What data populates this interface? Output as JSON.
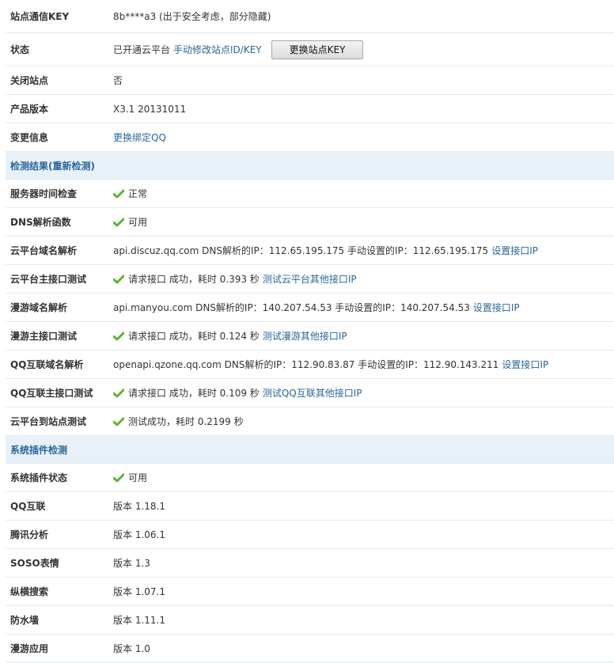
{
  "top": [
    {
      "label": "站点通信KEY",
      "text": "8b****a3 (出于安全考虑，部分隐藏)"
    },
    {
      "label": "状态",
      "text": "已开通云平台",
      "link": "手动修改站点ID/KEY",
      "button": "更换站点KEY"
    },
    {
      "label": "关闭站点",
      "text": "否"
    },
    {
      "label": "产品版本",
      "text": "X3.1 20131011"
    },
    {
      "label": "变更信息",
      "link": "更换绑定QQ"
    }
  ],
  "section1_title": "检测结果(重新检测)",
  "checks": [
    {
      "label": "服务器时间检查",
      "ok": true,
      "text": "正常"
    },
    {
      "label": "DNS解析函数",
      "ok": true,
      "text": "可用"
    },
    {
      "label": "云平台域名解析",
      "text": "api.discuz.qq.com DNS解析的IP：112.65.195.175 手动设置的IP：112.65.195.175",
      "link": "设置接口IP"
    },
    {
      "label": "云平台主接口测试",
      "ok": true,
      "text": "请求接口 成功，耗时 0.393 秒",
      "link": "测试云平台其他接口IP"
    },
    {
      "label": "漫游域名解析",
      "text": "api.manyou.com DNS解析的IP：140.207.54.53 手动设置的IP：140.207.54.53",
      "link": "设置接口IP"
    },
    {
      "label": "漫游主接口测试",
      "ok": true,
      "text": "请求接口 成功，耗时 0.124 秒",
      "link": "测试漫游其他接口IP"
    },
    {
      "label": "QQ互联域名解析",
      "text": "openapi.qzone.qq.com DNS解析的IP：112.90.83.87 手动设置的IP：112.90.143.211",
      "link": "设置接口IP"
    },
    {
      "label": "QQ互联主接口测试",
      "ok": true,
      "text": "请求接口 成功，耗时 0.109 秒",
      "link": "测试QQ互联其他接口IP"
    },
    {
      "label": "云平台到站点测试",
      "ok": true,
      "text": "测试成功，耗时 0.2199 秒"
    }
  ],
  "section2_title": "系统插件检测",
  "plugins": [
    {
      "label": "系统插件状态",
      "ok": true,
      "text": "可用"
    },
    {
      "label": "QQ互联",
      "text": "版本 1.18.1"
    },
    {
      "label": "腾讯分析",
      "text": "版本 1.06.1"
    },
    {
      "label": "SOSO表情",
      "text": "版本 1.3"
    },
    {
      "label": "纵横搜索",
      "text": "版本 1.07.1"
    },
    {
      "label": "防水墙",
      "text": "版本 1.11.1"
    },
    {
      "label": "漫游应用",
      "text": "版本 1.0"
    }
  ],
  "colors": {
    "link": "#2b6699",
    "ok": "#5cb531",
    "section_bg": "#e8f1f8"
  },
  "icons": {
    "ok": "check-icon"
  }
}
